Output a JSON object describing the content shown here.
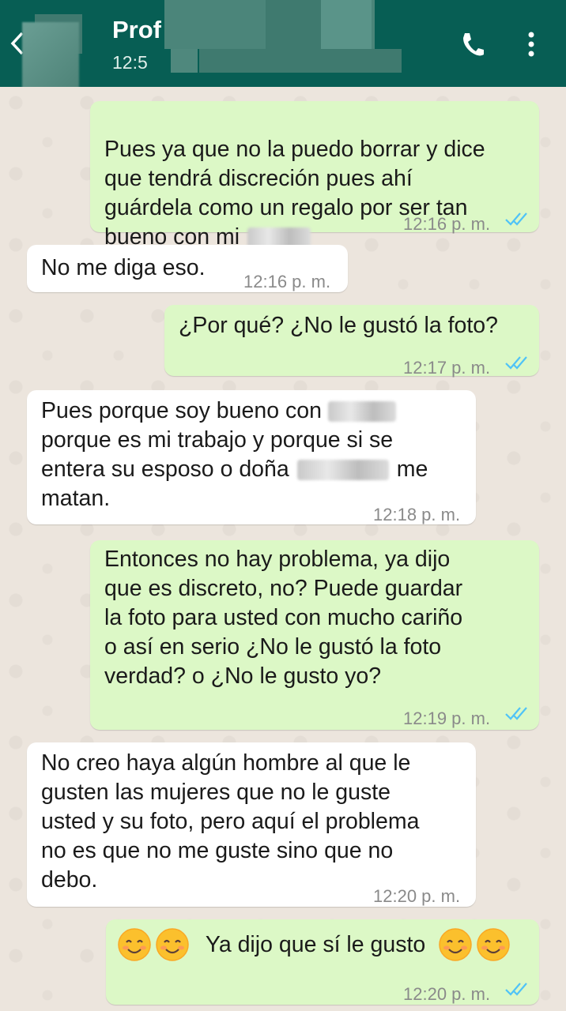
{
  "header": {
    "title": "Prof",
    "subtitle": "12:5",
    "back_icon": "back-arrow-icon",
    "call_icon": "call-icon",
    "menu_icon": "more-vertical-icon"
  },
  "colors": {
    "header_bg": "#075e54",
    "outgoing_bubble": "#dcf8c6",
    "incoming_bubble": "#ffffff",
    "read_ticks": "#4fc3f7",
    "chat_bg": "#ece5dd"
  },
  "messages": [
    {
      "dir": "out",
      "text_a": "Pues ya que no la puedo borrar y dice\nque tendrá discreción pues ahí\nguárdela como un regalo por ser tan\nbueno con mi",
      "time": "12:16 p. m.",
      "read": true
    },
    {
      "dir": "in",
      "text": "No me diga eso.",
      "time": "12:16 p. m."
    },
    {
      "dir": "out",
      "text": "¿Por qué? ¿No le gustó la foto?",
      "time": "12:17 p. m.",
      "read": true
    },
    {
      "dir": "in",
      "line1": "Pues porque soy bueno con",
      "line2": "porque es mi trabajo y porque si se",
      "line3a": "entera su esposo o doña",
      "line3b": "me",
      "line4": "matan.",
      "time": "12:18 p. m."
    },
    {
      "dir": "out",
      "text": "Entonces no hay problema, ya dijo\nque es discreto, no?  Puede guardar\nla foto para usted con mucho cariño\no así en serio ¿No le gustó la foto\nverdad? o ¿No le gusto yo?",
      "time": "12:19 p. m.",
      "read": true
    },
    {
      "dir": "in",
      "text": "No creo haya algún hombre al que le\ngusten las mujeres que no le guste\nusted y su foto, pero aquí el problema\nno es que no me guste sino que no\ndebo.",
      "time": "12:20 p. m."
    },
    {
      "dir": "out",
      "text": "Ya dijo que sí le gusto",
      "time": "12:20 p. m.",
      "read": true,
      "emoji": "smiling-face-emoji"
    }
  ]
}
